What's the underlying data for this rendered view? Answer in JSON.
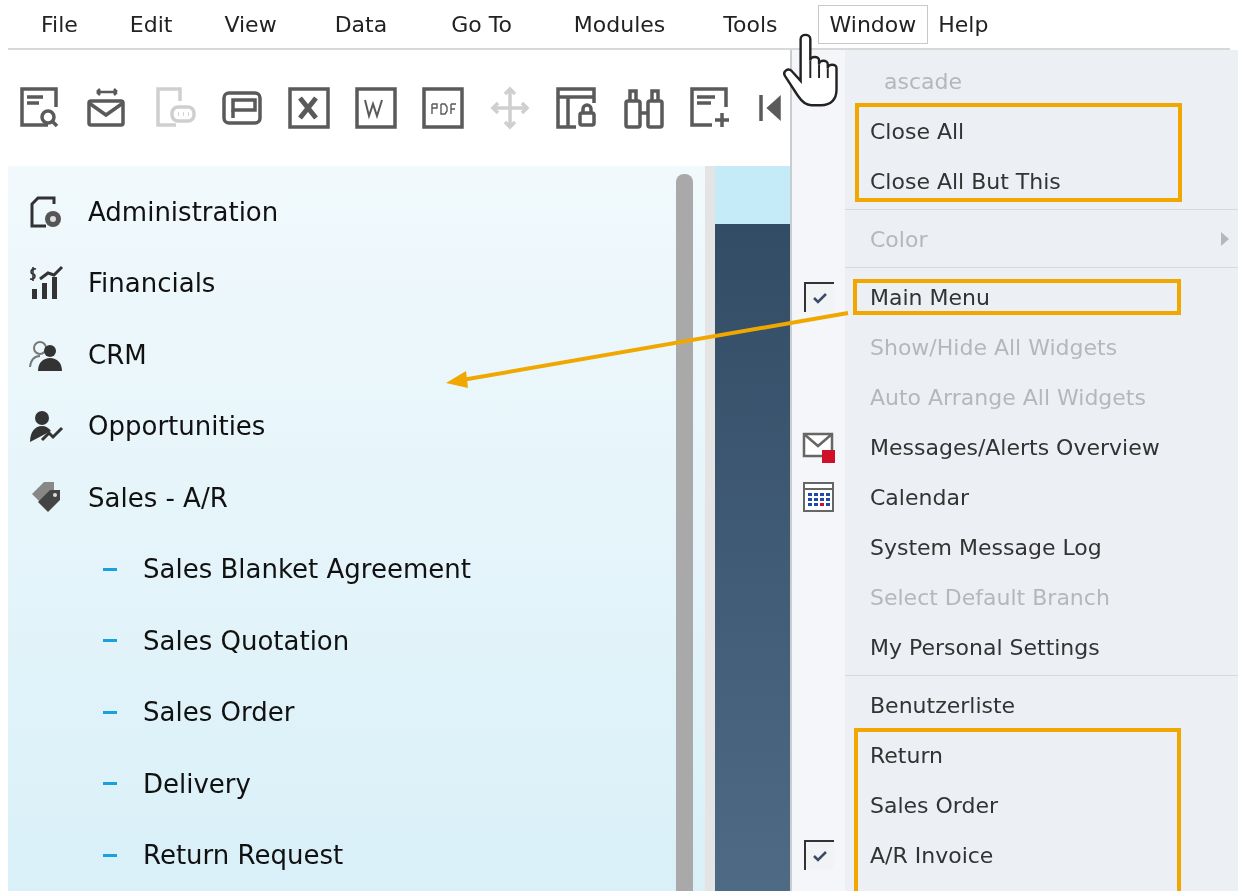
{
  "menu_bar": [
    {
      "label": "File",
      "selected": false
    },
    {
      "label": "Edit",
      "selected": false
    },
    {
      "label": "View",
      "selected": false
    },
    {
      "label": "Data",
      "selected": false
    },
    {
      "label": "Go To",
      "selected": false
    },
    {
      "label": "Modules",
      "selected": false
    },
    {
      "label": "Tools",
      "selected": false
    },
    {
      "label": "Window",
      "selected": true
    },
    {
      "label": "Help",
      "selected": false
    }
  ],
  "toolbar": [
    {
      "kind": "preview",
      "disabled": false
    },
    {
      "kind": "mail",
      "disabled": false
    },
    {
      "kind": "chat",
      "disabled": true
    },
    {
      "kind": "window",
      "disabled": false
    },
    {
      "kind": "excel",
      "disabled": false
    },
    {
      "kind": "word",
      "disabled": false
    },
    {
      "kind": "pdf",
      "disabled": false
    },
    {
      "kind": "move",
      "disabled": true
    },
    {
      "kind": "lock",
      "disabled": false
    },
    {
      "kind": "binoculars",
      "disabled": false
    },
    {
      "kind": "add",
      "disabled": false
    },
    {
      "kind": "first",
      "disabled": false
    }
  ],
  "sidebar": {
    "items": [
      {
        "label": "Administration",
        "kind": "admin"
      },
      {
        "label": "Financials",
        "kind": "chart"
      },
      {
        "label": "CRM",
        "kind": "people"
      },
      {
        "label": "Opportunities",
        "kind": "person"
      },
      {
        "label": "Sales - A/R",
        "kind": "tag",
        "children": [
          {
            "label": "Sales Blanket Agreement"
          },
          {
            "label": "Sales Quotation"
          },
          {
            "label": "Sales Order"
          },
          {
            "label": "Delivery"
          },
          {
            "label": "Return Request"
          }
        ]
      }
    ]
  },
  "window_menu": {
    "sections": [
      {
        "items": [
          {
            "label": "ascade",
            "kind": "plain",
            "disabled": true,
            "checked": false
          },
          {
            "label": "Close All",
            "kind": "plain",
            "disabled": false,
            "checked": false
          },
          {
            "label": "Close All But This",
            "kind": "plain",
            "disabled": false,
            "checked": false
          }
        ]
      },
      {
        "items": [
          {
            "label": "Color",
            "kind": "submenu",
            "disabled": true,
            "checked": false
          }
        ]
      },
      {
        "items": [
          {
            "label": "Main Menu",
            "kind": "plain",
            "disabled": false,
            "checked": true
          },
          {
            "label": "Show/Hide All Widgets",
            "kind": "plain",
            "disabled": true,
            "checked": false
          },
          {
            "label": "Auto Arrange All Widgets",
            "kind": "plain",
            "disabled": true,
            "checked": false
          },
          {
            "label": "Messages/Alerts Overview",
            "kind": "envelope",
            "disabled": false,
            "checked": false
          },
          {
            "label": "Calendar",
            "kind": "calendar",
            "disabled": false,
            "checked": false
          },
          {
            "label": "System Message Log",
            "kind": "plain",
            "disabled": false,
            "checked": false
          },
          {
            "label": "Select Default Branch",
            "kind": "plain",
            "disabled": true,
            "checked": false
          },
          {
            "label": "My Personal Settings",
            "kind": "plain",
            "disabled": false,
            "checked": false
          }
        ]
      },
      {
        "items": [
          {
            "label": "Benutzerliste",
            "kind": "plain",
            "disabled": false,
            "checked": false
          },
          {
            "label": "Return",
            "kind": "plain",
            "disabled": false,
            "checked": false
          },
          {
            "label": "Sales Order",
            "kind": "plain",
            "disabled": false,
            "checked": false
          },
          {
            "label": "A/R Invoice",
            "kind": "plain",
            "disabled": false,
            "checked": true
          }
        ]
      }
    ]
  }
}
